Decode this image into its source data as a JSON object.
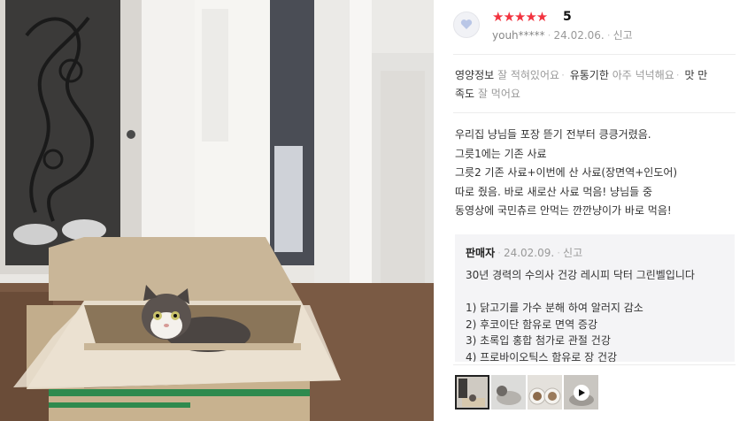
{
  "review": {
    "stars": "★★★★★",
    "score": "5",
    "user": "youh*****",
    "date": "24.02.06.",
    "report": "신고",
    "attributes": [
      {
        "key": "영양정보",
        "value": "잘 적혀있어요"
      },
      {
        "key": "유통기한",
        "value": "아주 넉넉해요"
      },
      {
        "key": "맛 만족도",
        "value": "잘 먹어요"
      }
    ],
    "body_lines": [
      "우리집 냥님들 포장 뜯기 전부터 킁킁거렸음.",
      "그릇1에는 기존 사료",
      "그릇2 기존 사료+이번에 산 사료(장면역+인도어)",
      "따로 줬음. 바로 새로산 사료 먹음! 냥님들 중",
      "동영상에 국민츄르 안먹는  깐깐냥이가 바로 먹음!"
    ]
  },
  "seller_reply": {
    "label": "판매자",
    "date": "24.02.09.",
    "report": "신고",
    "lines": [
      "30년 경력의 수의사 건강 레시피 닥터 그린벨입니다",
      "",
      "1) 닭고기를 가수 분해 하여 알러지 감소",
      "2) 후코이단 함유로 면역 증강",
      "3) 초록입 홍합 첨가로 관절 건강",
      "4) 프로바이오틱스 함유로 장 건강"
    ]
  },
  "thumbnails": [
    {
      "name": "photo-1",
      "selected": true
    },
    {
      "name": "photo-2",
      "selected": false
    },
    {
      "name": "photo-3",
      "selected": false
    },
    {
      "name": "video-1",
      "selected": false,
      "icon": "play-icon"
    }
  ],
  "colors": {
    "star": "#f2333f",
    "reply_bg": "#f4f4f6",
    "muted": "#999999"
  }
}
